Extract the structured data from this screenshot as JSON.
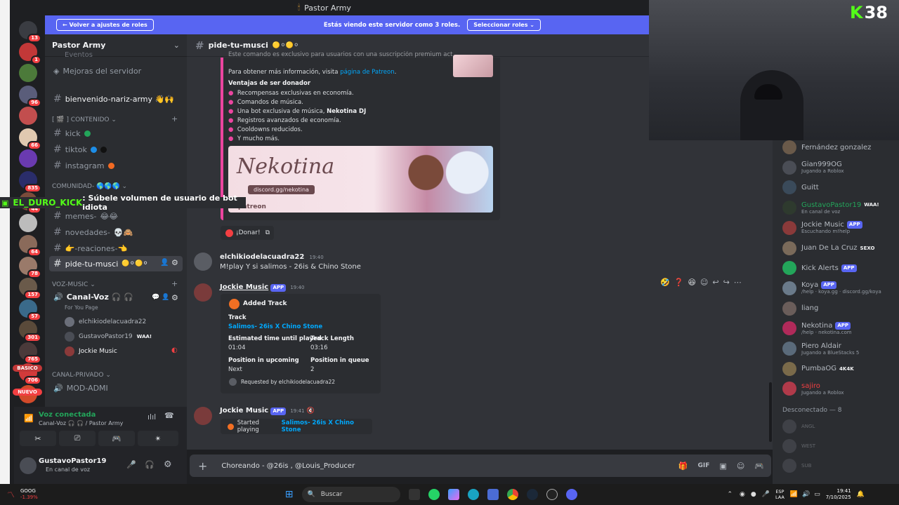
{
  "window_title": "Pastor Army",
  "banner": {
    "back": "Volver a ajustes de roles",
    "text": "Estás viendo este servidor como 3 roles.",
    "select": "Seleccionar roles"
  },
  "server_badges": [
    "13",
    "1",
    "",
    "96",
    "",
    "66",
    "",
    "835",
    "44",
    "",
    "64",
    "78",
    "157",
    "57",
    "301",
    "765",
    "706",
    "",
    ""
  ],
  "server_labels": {
    "basico": "BASICO",
    "nuevo": "NUEVO"
  },
  "server": {
    "name": "Pastor Army"
  },
  "sidebar": {
    "top_items": [
      "Eventos",
      "Mejoras del servidor"
    ],
    "welcome": "bienvenido-nariz-army 👋🙌",
    "cat_contenido": "[ 🎬 ] CONTENIDO",
    "contenido": [
      "kick",
      "tiktok",
      "instagram"
    ],
    "cat_comunidad": "COMUNIDAD-",
    "comunidad": [
      "memes-",
      "novedades-",
      "👉-reaciones-👈",
      "pide-tu-musci"
    ],
    "cat_voz": "Voz-music",
    "voice_channel": "Canal-Voz 🎧 🎧",
    "voice_sub": "For You Page",
    "voice_users": [
      "elchikiodelacuadra22",
      "GustavoPastor19",
      "Jockie Music"
    ],
    "voice_badge": "WAA!",
    "cat_privado": "CANAL-PRIVADO",
    "privado": [
      "MOD-ADMI"
    ]
  },
  "voice_panel": {
    "status": "Voz conectada",
    "channel": "Canal-Voz 🎧 🎧 / Pastor Army"
  },
  "user_panel": {
    "name": "GustavoPastor19",
    "status": "En canal de voz"
  },
  "overlay": {
    "user": "EL_DURO_KICK",
    "text": ": Súbele volumen de usuario de bot idiota"
  },
  "chat": {
    "channel": "pide-tu-musci",
    "embed1": {
      "cut_text": "Este comando es exclusivo para usuarios con una suscripción premium activa.",
      "info_prefix": "Para obtener más información, visita ",
      "info_link": "página de Patreon",
      "heading": "Ventajas de ser donador",
      "bullets": [
        "Recompensas exclusivas en economía.",
        "Comandos de música.",
        "Una bot exclusiva de música, ",
        "Registros avanzados de economía.",
        "Cooldowns reducidos.",
        "Y mucho más."
      ],
      "bullet_bold": "Nekotina DJ",
      "image_text": "Nekotina",
      "image_sub": "discord.gg/nekotina",
      "image_patreon": "patreon",
      "button": "¡Donar!"
    },
    "msg1": {
      "user": "elchikiodelacuadra22",
      "time": "19:40",
      "text": "M!play Y si salimos - 26is & Chino Stone"
    },
    "msg2": {
      "user": "Jockie Music",
      "tag": "APP",
      "time": "19:40",
      "title": "Added Track",
      "f_track": "Track",
      "track": "Salimos- 26is X Chino Stone",
      "f_est": "Estimated time until played",
      "est": "01:04",
      "f_len": "Track Length",
      "len": "03:16",
      "f_up": "Position in upcoming",
      "up": "Next",
      "f_q": "Position in queue",
      "q": "2",
      "footer": "Requested by elchikiodelacuadra22"
    },
    "msg3": {
      "user": "Jockie Music",
      "tag": "APP",
      "time": "19:41",
      "prefix": "Started playing ",
      "track": "Salimos- 26is X Chino Stone"
    },
    "input": "Choreando - @26is , @Louis_Producer"
  },
  "members": [
    {
      "name": "Fernández gonzalez",
      "status": ""
    },
    {
      "name": "Gian999OG",
      "status": "Jugando a Roblox"
    },
    {
      "name": "Guitt",
      "status": ""
    },
    {
      "name": "GustavoPastor19",
      "status": "En canal de voz",
      "badge": "WAA!"
    },
    {
      "name": "Jockie Music",
      "status": "Escuchando m!help",
      "tag": "APP"
    },
    {
      "name": "Juan De La Cruz",
      "status": "",
      "badge": "SEXO"
    },
    {
      "name": "Kick Alerts",
      "status": "",
      "tag": "APP"
    },
    {
      "name": "Koya",
      "status": "/help · koya.gg · discord.gg/koya",
      "tag": "APP"
    },
    {
      "name": "liang",
      "status": ""
    },
    {
      "name": "Nekotina",
      "status": "/help · nekotina.com",
      "tag": "APP"
    },
    {
      "name": "Piero Aldair",
      "status": "Jugando a BlueStacks 5"
    },
    {
      "name": "PumbaOG",
      "status": "",
      "badge": "4K4K"
    },
    {
      "name": "sajiro",
      "status": "Jugando a Roblox"
    }
  ],
  "offline_header": "Desconectado — 8",
  "offline": [
    {
      "name": "ANGL"
    },
    {
      "name": "WEST"
    },
    {
      "name": "SUB"
    }
  ],
  "webcam_logo": "38",
  "taskbar": {
    "ticker": "GOOG",
    "change": "-1.39%",
    "search": "Buscar",
    "lang1": "ESP",
    "lang2": "LAA",
    "time": "19:41",
    "date": "7/10/2025"
  }
}
